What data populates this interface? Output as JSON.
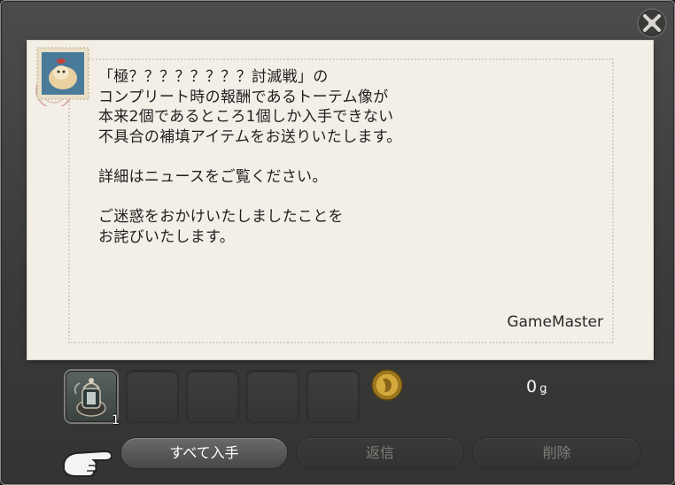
{
  "letter": {
    "message_lines": [
      "「極？？？？？？？？討滅戦」の",
      "コンプリート時の報酬であるトーテム像が",
      "本来2個であるところ1個しか入手できない",
      "不具合の補填アイテムをお送りいたします。",
      "",
      "詳細はニュースをご覧ください。",
      "",
      "ご迷惑をおかけいたしましたことを",
      "お詫びいたします。"
    ],
    "signature": "GameMaster"
  },
  "attachments": {
    "items": [
      {
        "quantity": "1",
        "icon": "lantern-totem-item-icon"
      },
      {
        "quantity": "",
        "icon": ""
      },
      {
        "quantity": "",
        "icon": ""
      },
      {
        "quantity": "",
        "icon": ""
      },
      {
        "quantity": "",
        "icon": ""
      }
    ],
    "gil_amount": "0",
    "gil_symbol": "ǥ"
  },
  "buttons": {
    "receive_all": "すべて入手",
    "reply": "返信",
    "delete": "削除"
  },
  "colors": {
    "paper": "#f3efe7",
    "window": "#3d3d3c",
    "active_button": "#5a5a59",
    "disabled_text": "#7d7d7a"
  }
}
